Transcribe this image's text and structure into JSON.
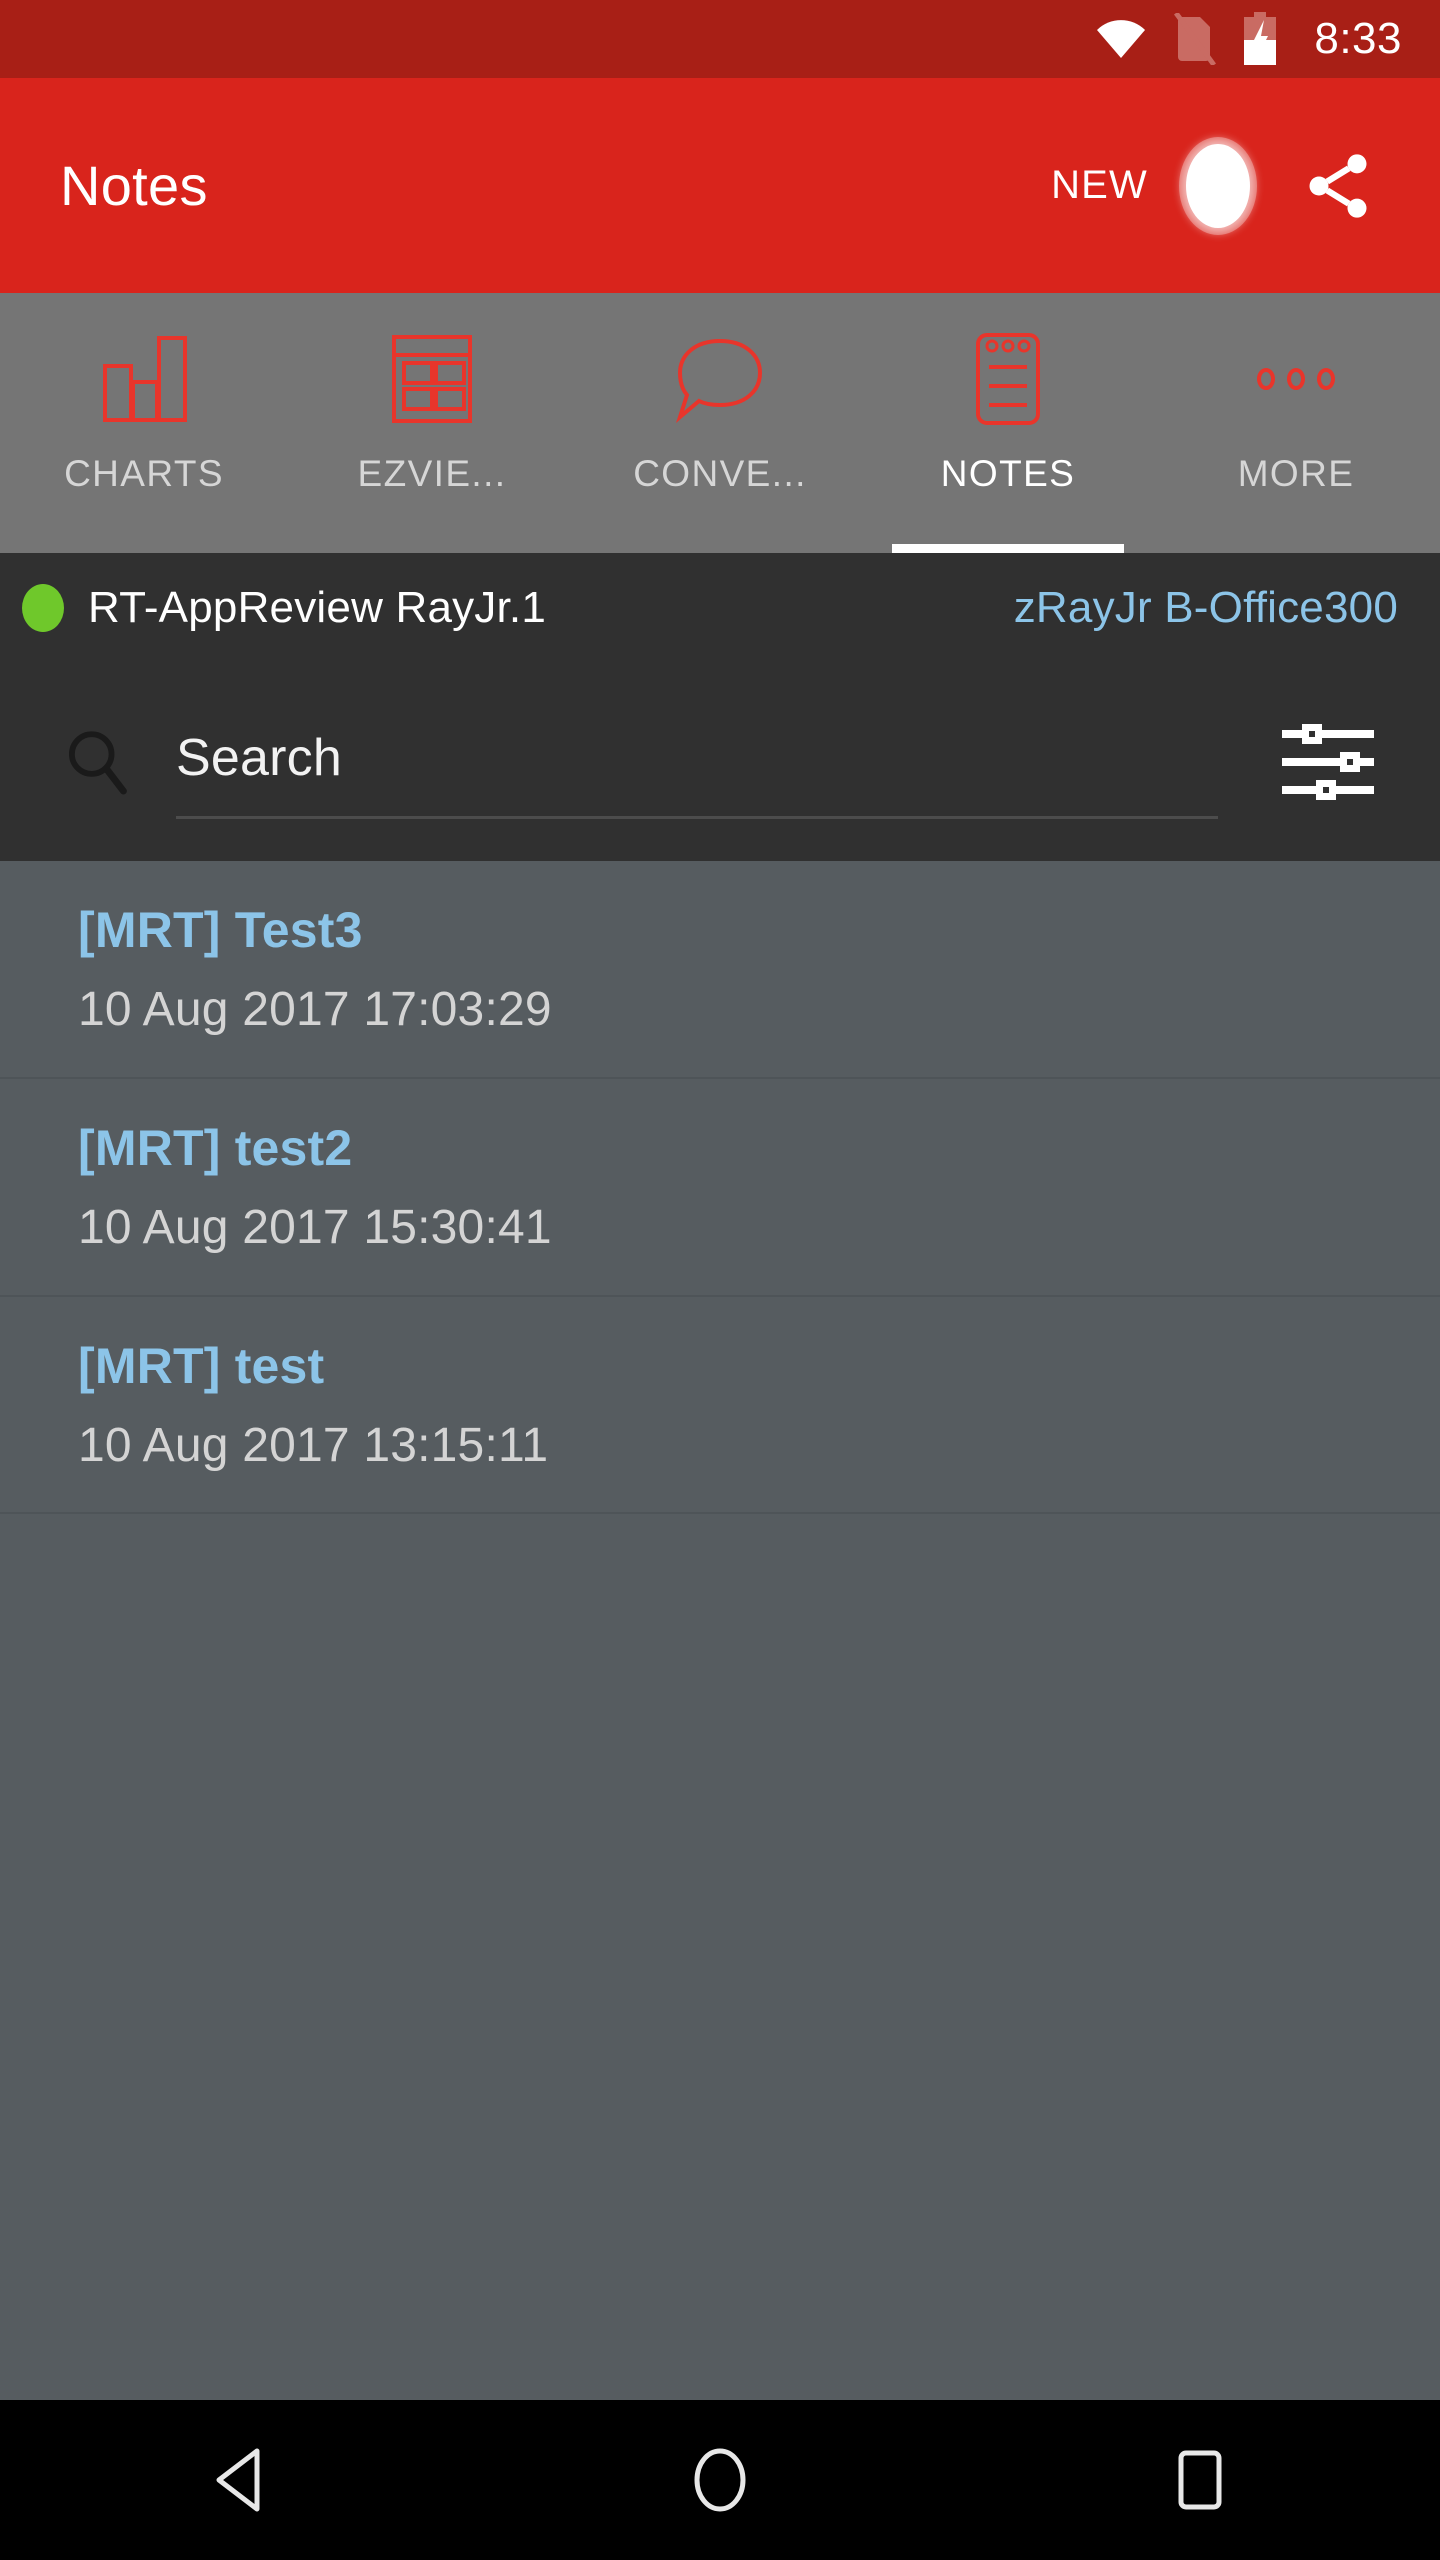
{
  "status_bar": {
    "time": "8:33",
    "icons": [
      "wifi-icon",
      "no-sim-icon",
      "battery-charging-icon"
    ],
    "background": "#A81F16"
  },
  "app_bar": {
    "title": "Notes",
    "new_label": "NEW",
    "mic_icon": "microphone-icon",
    "share_icon": "share-icon",
    "background": "#D9241C"
  },
  "tabs": {
    "background": "#757575",
    "active_index": 3,
    "items": [
      {
        "label": "CHARTS",
        "icon": "bar-chart-icon"
      },
      {
        "label": "EZVIE...",
        "icon": "grid-table-icon"
      },
      {
        "label": "CONVE...",
        "icon": "speech-bubble-icon"
      },
      {
        "label": "NOTES",
        "icon": "notepad-icon"
      },
      {
        "label": "MORE",
        "icon": "more-dots-icon"
      }
    ]
  },
  "account": {
    "status_color": "#6FC82B",
    "name": "RT-AppReview RayJr.1",
    "organization": "zRayJr B-Office300",
    "organization_color": "#8CC4E8",
    "background": "#303030"
  },
  "search": {
    "placeholder": "Search",
    "value": "",
    "search_icon": "magnifier-icon",
    "filter_icon": "sliders-filter-icon"
  },
  "notes": {
    "background": "#565C60",
    "title_color": "#8CC4E8",
    "date_color": "#D4D4D4",
    "items": [
      {
        "title": "[MRT] Test3",
        "date": "10 Aug 2017 17:03:29"
      },
      {
        "title": "[MRT] test2",
        "date": "10 Aug 2017 15:30:41"
      },
      {
        "title": "[MRT] test",
        "date": "10 Aug 2017 13:15:11"
      }
    ]
  },
  "nav_bar": {
    "background": "#000000",
    "back": "back-triangle-icon",
    "home": "home-circle-icon",
    "recents": "recents-square-icon"
  }
}
